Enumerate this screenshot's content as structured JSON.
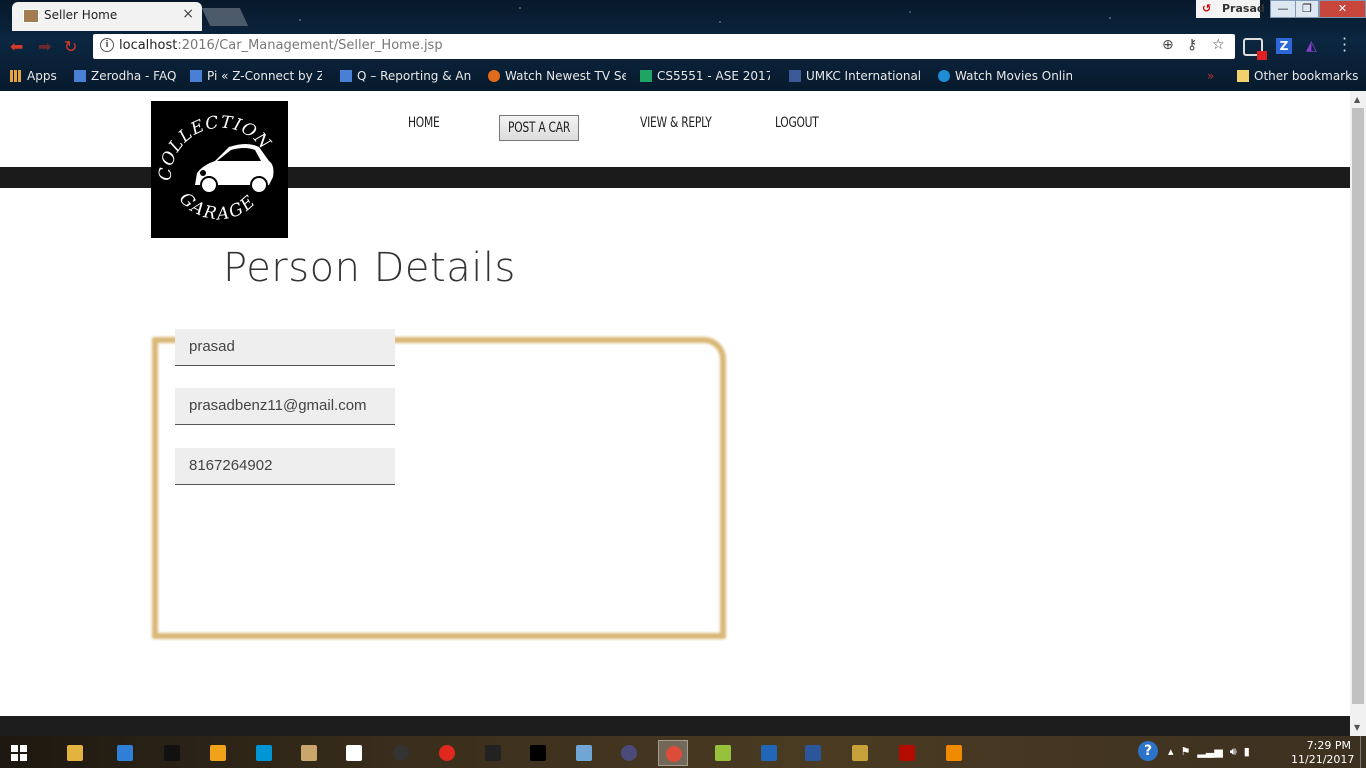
{
  "browser": {
    "tab_title": "Seller Home",
    "profile_name": "Prasad",
    "url_host": "localhost",
    "url_path": ":2016/Car_Management/Seller_Home.jsp",
    "bookmarks": [
      {
        "label": "Apps",
        "icon": "apps-grid-icon",
        "color": "#e8a33d"
      },
      {
        "label": "Zerodha - FAQ",
        "icon": "doc-icon",
        "color": "#4a7fd6"
      },
      {
        "label": "Pi « Z-Connect by Ze",
        "icon": "doc-icon",
        "color": "#4a7fd6"
      },
      {
        "label": "Q – Reporting & An",
        "icon": "doc-icon",
        "color": "#4a7fd6"
      },
      {
        "label": "Watch Newest TV Se",
        "icon": "puzzle-icon",
        "color": "#e26b1c"
      },
      {
        "label": "CS5551 - ASE 2017",
        "icon": "sheet-icon",
        "color": "#1fa463"
      },
      {
        "label": "UMKC International",
        "icon": "facebook-icon",
        "color": "#3b5998"
      },
      {
        "label": "Watch Movies Onlin",
        "icon": "play-circle-icon",
        "color": "#1f8dd6"
      }
    ],
    "other_bookmarks": "Other bookmarks"
  },
  "site": {
    "nav": {
      "home": "HOME",
      "post_a_car": "POST A CAR",
      "view_reply": "VIEW & REPLY",
      "logout": "LOGOUT"
    },
    "logo": {
      "top_text": "COLLECTION",
      "bottom_text": "GARAGE"
    },
    "heading": "Person Details",
    "fields": {
      "name": "prasad",
      "email": "prasadbenz11@gmail.com",
      "phone": "8167264902"
    },
    "frame_color": "#d9b878"
  },
  "taskbar": {
    "time": "7:29 PM",
    "date": "11/21/2017",
    "apps": [
      {
        "name": "file-explorer-icon",
        "color": "#e3b33f"
      },
      {
        "name": "internet-explorer-icon",
        "color": "#2f7fd6"
      },
      {
        "name": "media-icon",
        "color": "#111111"
      },
      {
        "name": "player-icon",
        "color": "#f0a21a"
      },
      {
        "name": "hp-icon",
        "color": "#0096d6"
      },
      {
        "name": "word-doc-icon",
        "color": "#c9a66b"
      },
      {
        "name": "app-icon",
        "color": "#ffffff"
      },
      {
        "name": "app-round-icon",
        "color": "#333333"
      },
      {
        "name": "opera-icon",
        "color": "#e0281f"
      },
      {
        "name": "webstorm-icon",
        "color": "#222222"
      },
      {
        "name": "intellij-icon",
        "color": "#000000"
      },
      {
        "name": "virtualbox-icon",
        "color": "#6fa6d6"
      },
      {
        "name": "eclipse-icon",
        "color": "#4b4a7a"
      },
      {
        "name": "chrome-icon",
        "color": "#dd4b39"
      },
      {
        "name": "android-icon",
        "color": "#97c03d"
      },
      {
        "name": "r-icon",
        "color": "#2266b8"
      },
      {
        "name": "word-icon",
        "color": "#2b579a"
      },
      {
        "name": "paint-icon",
        "color": "#c7a23a"
      },
      {
        "name": "acrobat-icon",
        "color": "#b30b00"
      },
      {
        "name": "vlc-icon",
        "color": "#f08a00"
      }
    ]
  }
}
